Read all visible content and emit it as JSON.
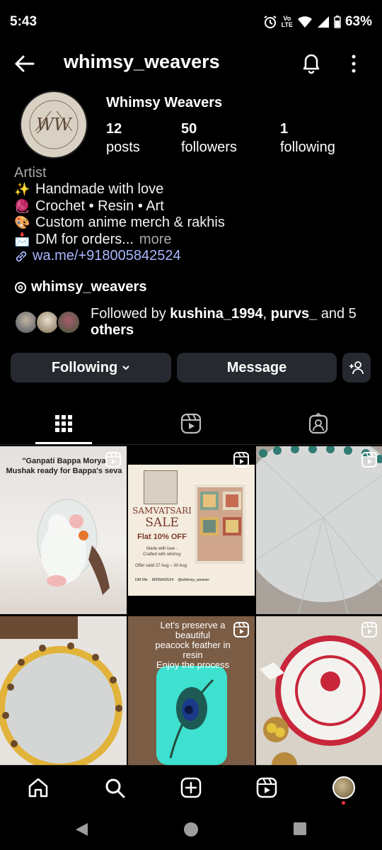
{
  "status_bar": {
    "time": "5:43",
    "volte_top": "Vo",
    "volte_bottom": "LTE",
    "battery": "63%"
  },
  "header": {
    "username": "whimsy_weavers"
  },
  "profile": {
    "display_name": "Whimsy Weavers",
    "avatar_logo_text": "WW",
    "stats": [
      {
        "value": "12",
        "label": "posts"
      },
      {
        "value": "50",
        "label": "followers"
      },
      {
        "value": "1",
        "label": "following"
      }
    ],
    "category": "Artist",
    "bio_lines": [
      {
        "emoji": "✨",
        "text": "Handmade with love"
      },
      {
        "emoji": "🧶",
        "text": "Crochet • Resin • Art"
      },
      {
        "emoji": "🎨",
        "text": "Custom anime merch & rakhis"
      },
      {
        "emoji": "📩",
        "text": "DM for orders..."
      }
    ],
    "more_label": "more",
    "link": "wa.me/+918005842524",
    "threads_handle": "whimsy_weavers",
    "followed_by": {
      "prefix": "Followed by ",
      "user1": "kushina_1994",
      "sep": ", ",
      "user2": "purvs_",
      "suffix": " and 5",
      "suffix2": "others"
    }
  },
  "actions": {
    "following_label": "Following",
    "message_label": "Message"
  },
  "posts": {
    "captions": {
      "post1": "\"Ganpati Bappa Morya\nMushak ready for Bappa's seva",
      "post5": "Let's preserve a\nbeautiful\npeacock feather in\nresin\nEnjoy the process"
    },
    "sale_card": {
      "title_line1": "SAMVATSARI",
      "title_line2": "SALE",
      "offer": "Flat 10% OFF",
      "tag1": "Made with love -",
      "tag2": "Crafted with whimsy",
      "validity": "Offer valid 27 Aug – 30 Aug",
      "dm": "DM Me",
      "phone": "8005842524",
      "handle": "@whimsy_weaver"
    }
  },
  "colors": {
    "background": "#000000",
    "button": "#262a30",
    "link": "#a9b7ff",
    "muted": "#a8a8a8",
    "notification_dot": "#ff3040"
  }
}
